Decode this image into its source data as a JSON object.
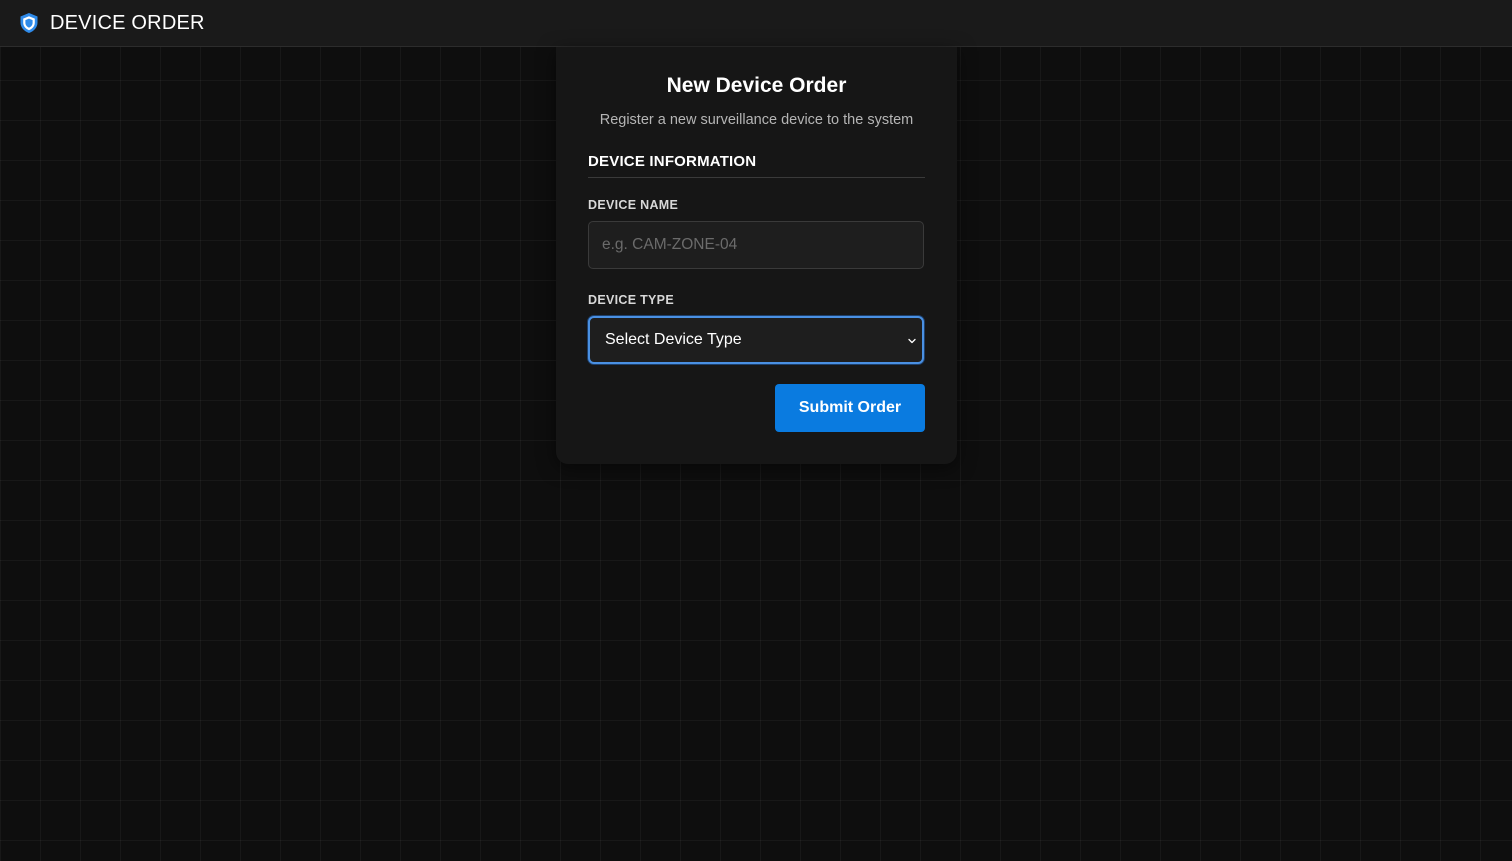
{
  "header": {
    "title": "DEVICE ORDER",
    "logo_icon": "shield-icon",
    "accent_color": "#2f8bea"
  },
  "form": {
    "title": "New Device Order",
    "subtitle": "Register a new surveillance device to the system",
    "section_heading": "DEVICE INFORMATION",
    "device_name": {
      "label": "DEVICE NAME",
      "value": "",
      "placeholder": "e.g. CAM-ZONE-04"
    },
    "device_type": {
      "label": "DEVICE TYPE",
      "selected": "Select Device Type",
      "icon": "chevron-down-icon"
    },
    "submit_label": "Submit Order",
    "submit_color": "#0a7be0"
  }
}
